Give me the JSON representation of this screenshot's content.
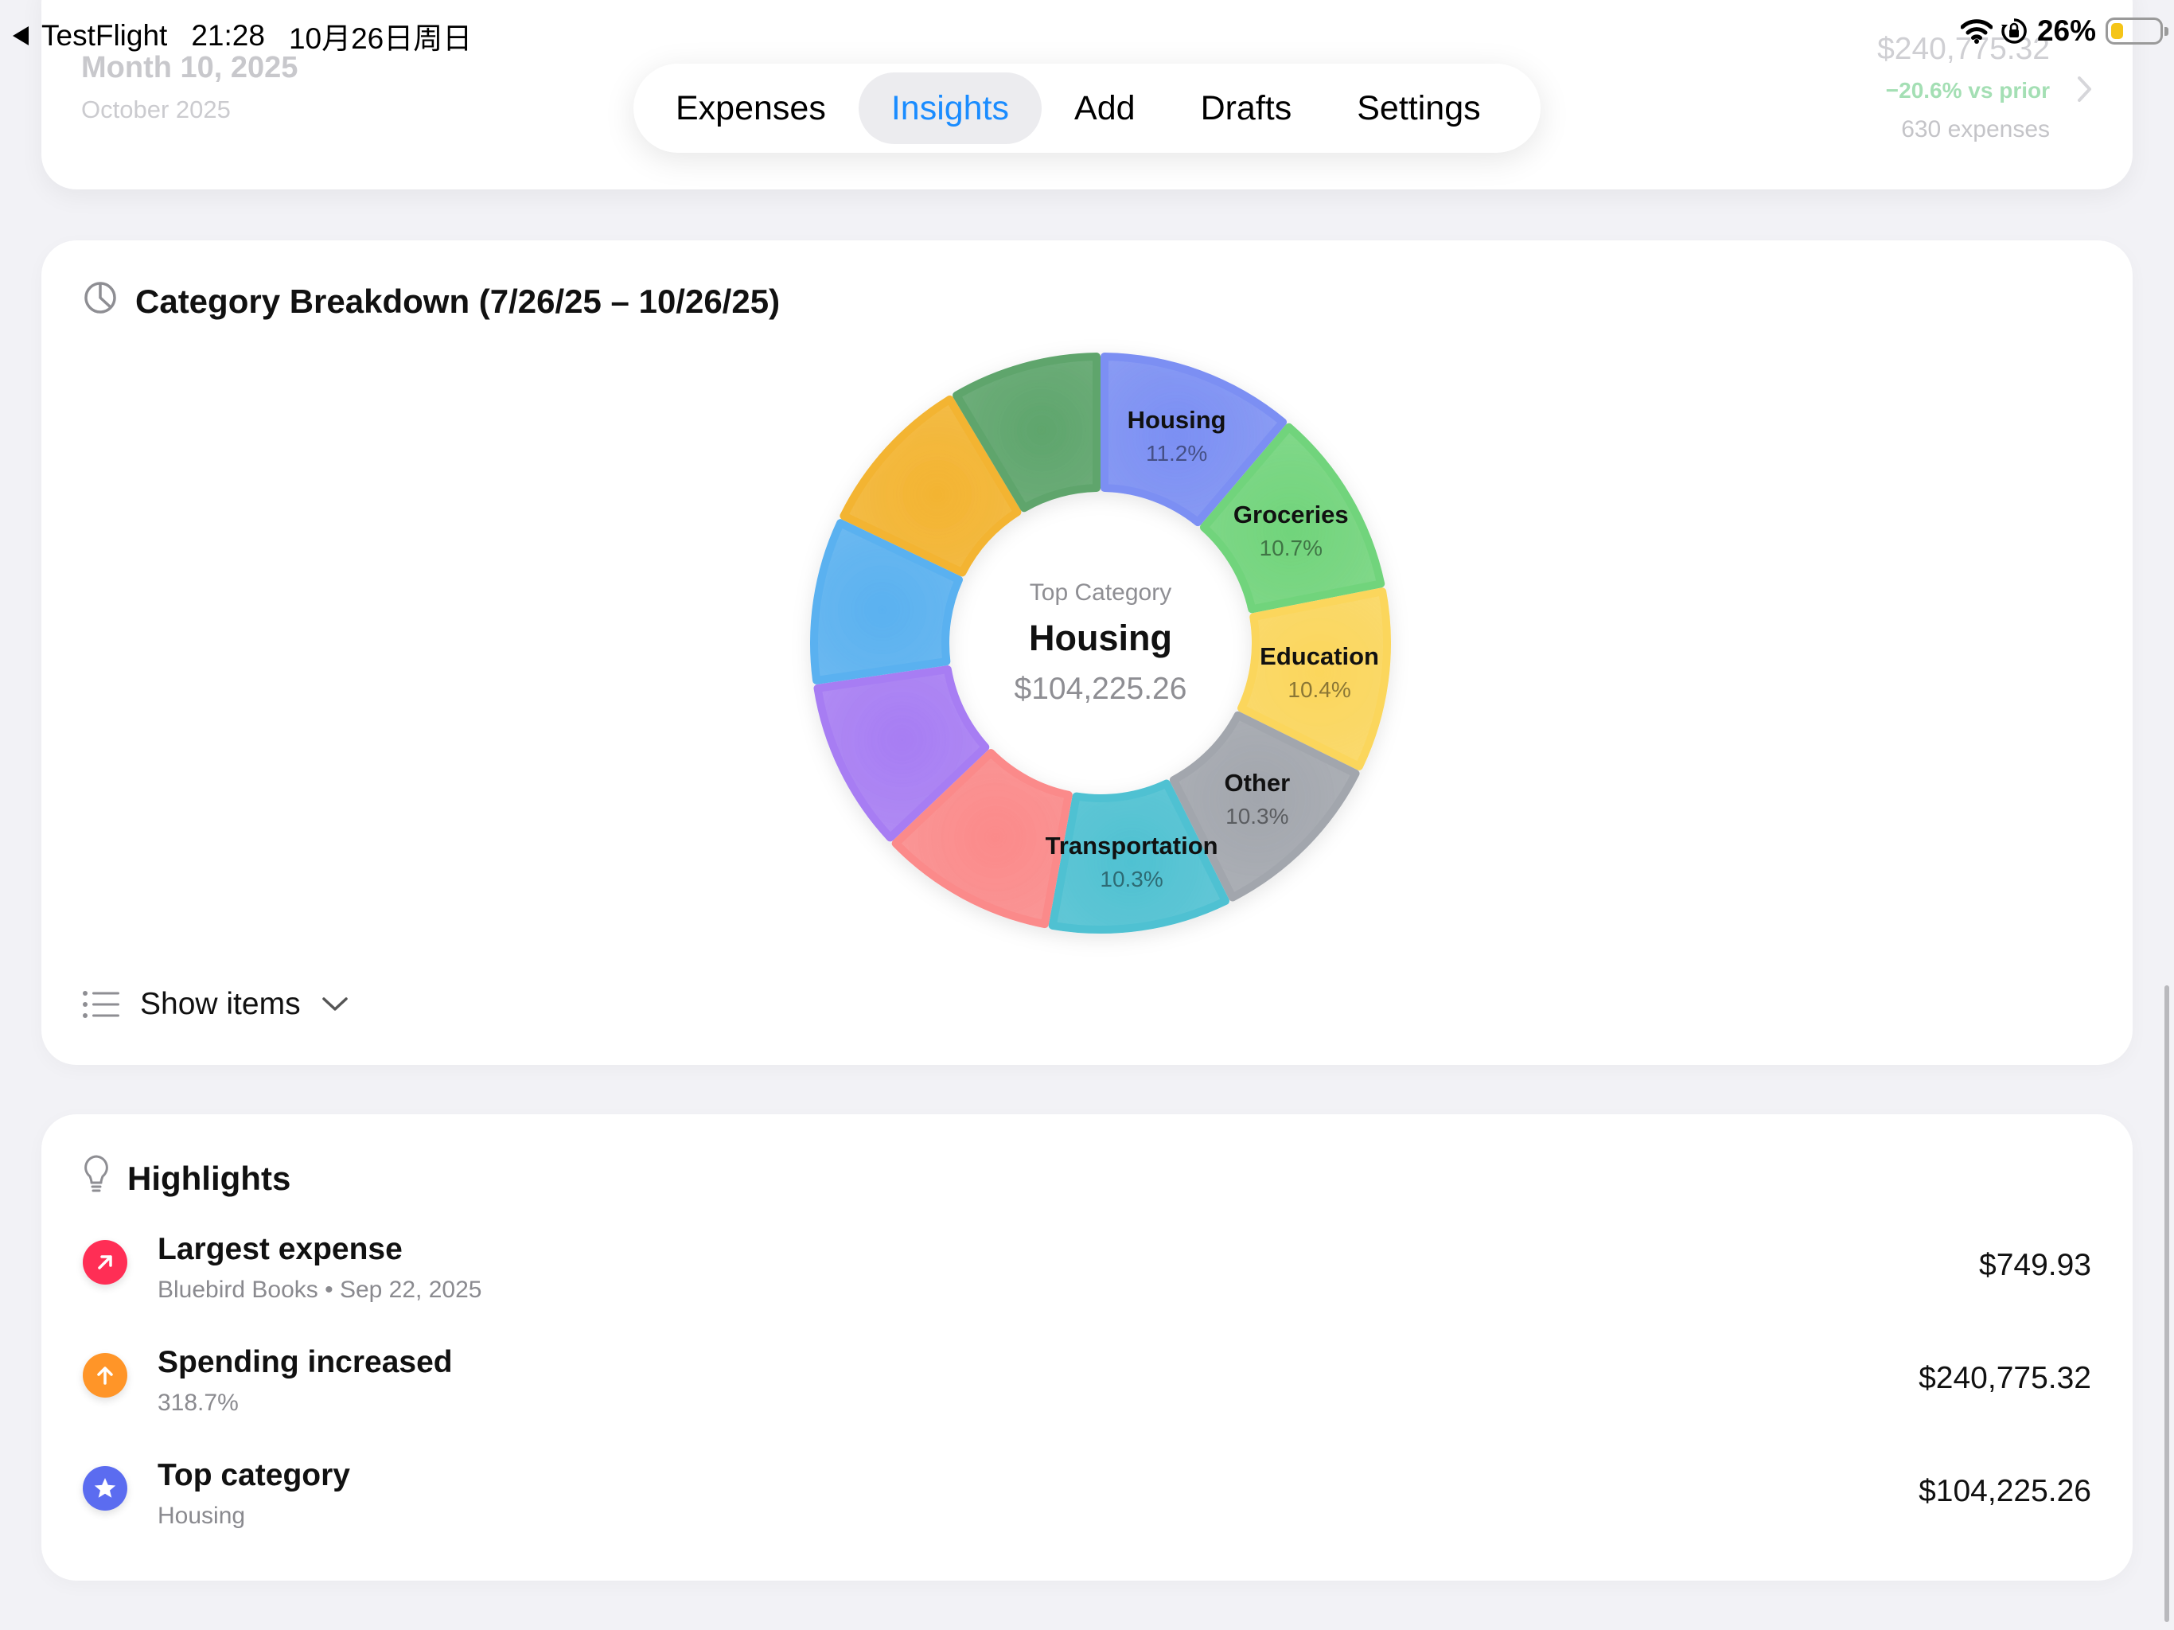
{
  "status_bar": {
    "back_app": "TestFlight",
    "time": "21:28",
    "date": "10月26日周日",
    "battery_percent": "26%",
    "battery_level": 0.26,
    "battery_color": "#f5c518"
  },
  "summary": {
    "date_title": "Month 10, 2025",
    "month_label": "October 2025",
    "total": "$240,775.32",
    "delta": "−20.6% vs prior",
    "count": "630 expenses"
  },
  "tabs": [
    {
      "label": "Expenses",
      "active": false
    },
    {
      "label": "Insights",
      "active": true
    },
    {
      "label": "Add",
      "active": false
    },
    {
      "label": "Drafts",
      "active": false
    },
    {
      "label": "Settings",
      "active": false
    }
  ],
  "breakdown": {
    "title": "Category Breakdown (7/26/25 – 10/26/25)",
    "center_kicker": "Top Category",
    "center_name": "Housing",
    "center_amount": "$104,225.26",
    "show_items_label": "Show items"
  },
  "chart_data": {
    "type": "pie",
    "start_angle_deg": 0,
    "slices": [
      {
        "name": "Housing",
        "label": "11.2%",
        "value": 11.2,
        "color": "#7b8ff3",
        "labeled": true
      },
      {
        "name": "Groceries",
        "label": "10.7%",
        "value": 10.7,
        "color": "#71d47b",
        "labeled": true
      },
      {
        "name": "Education",
        "label": "10.4%",
        "value": 10.4,
        "color": "#fbd65c",
        "labeled": true
      },
      {
        "name": "Other",
        "label": "10.3%",
        "value": 10.3,
        "color": "#a2a6ad",
        "labeled": true
      },
      {
        "name": "Transportation",
        "label": "10.3%",
        "value": 10.3,
        "color": "#4fc1d2",
        "labeled": true
      },
      {
        "name": "",
        "label": "",
        "value": 10.0,
        "color": "#fb8a8a",
        "labeled": false
      },
      {
        "name": "",
        "label": "",
        "value": 9.8,
        "color": "#a77df3",
        "labeled": false
      },
      {
        "name": "",
        "label": "",
        "value": 9.4,
        "color": "#5ab1f0",
        "labeled": false
      },
      {
        "name": "",
        "label": "",
        "value": 9.3,
        "color": "#f3b431",
        "labeled": false
      },
      {
        "name": "",
        "label": "",
        "value": 8.6,
        "color": "#5ea56c",
        "labeled": false
      }
    ]
  },
  "highlights": {
    "title": "Highlights",
    "items": [
      {
        "icon": "arrow-up-right-icon",
        "color": "#ff2e55",
        "title": "Largest expense",
        "subtitle": "Bluebird Books • Sep 22, 2025",
        "value": "$749.93"
      },
      {
        "icon": "arrow-up-icon",
        "color": "#ff9528",
        "title": "Spending increased",
        "subtitle": "318.7%",
        "value": "$240,775.32"
      },
      {
        "icon": "star-icon",
        "color": "#5b6cf0",
        "title": "Top category",
        "subtitle": "Housing",
        "value": "$104,225.26"
      }
    ]
  }
}
